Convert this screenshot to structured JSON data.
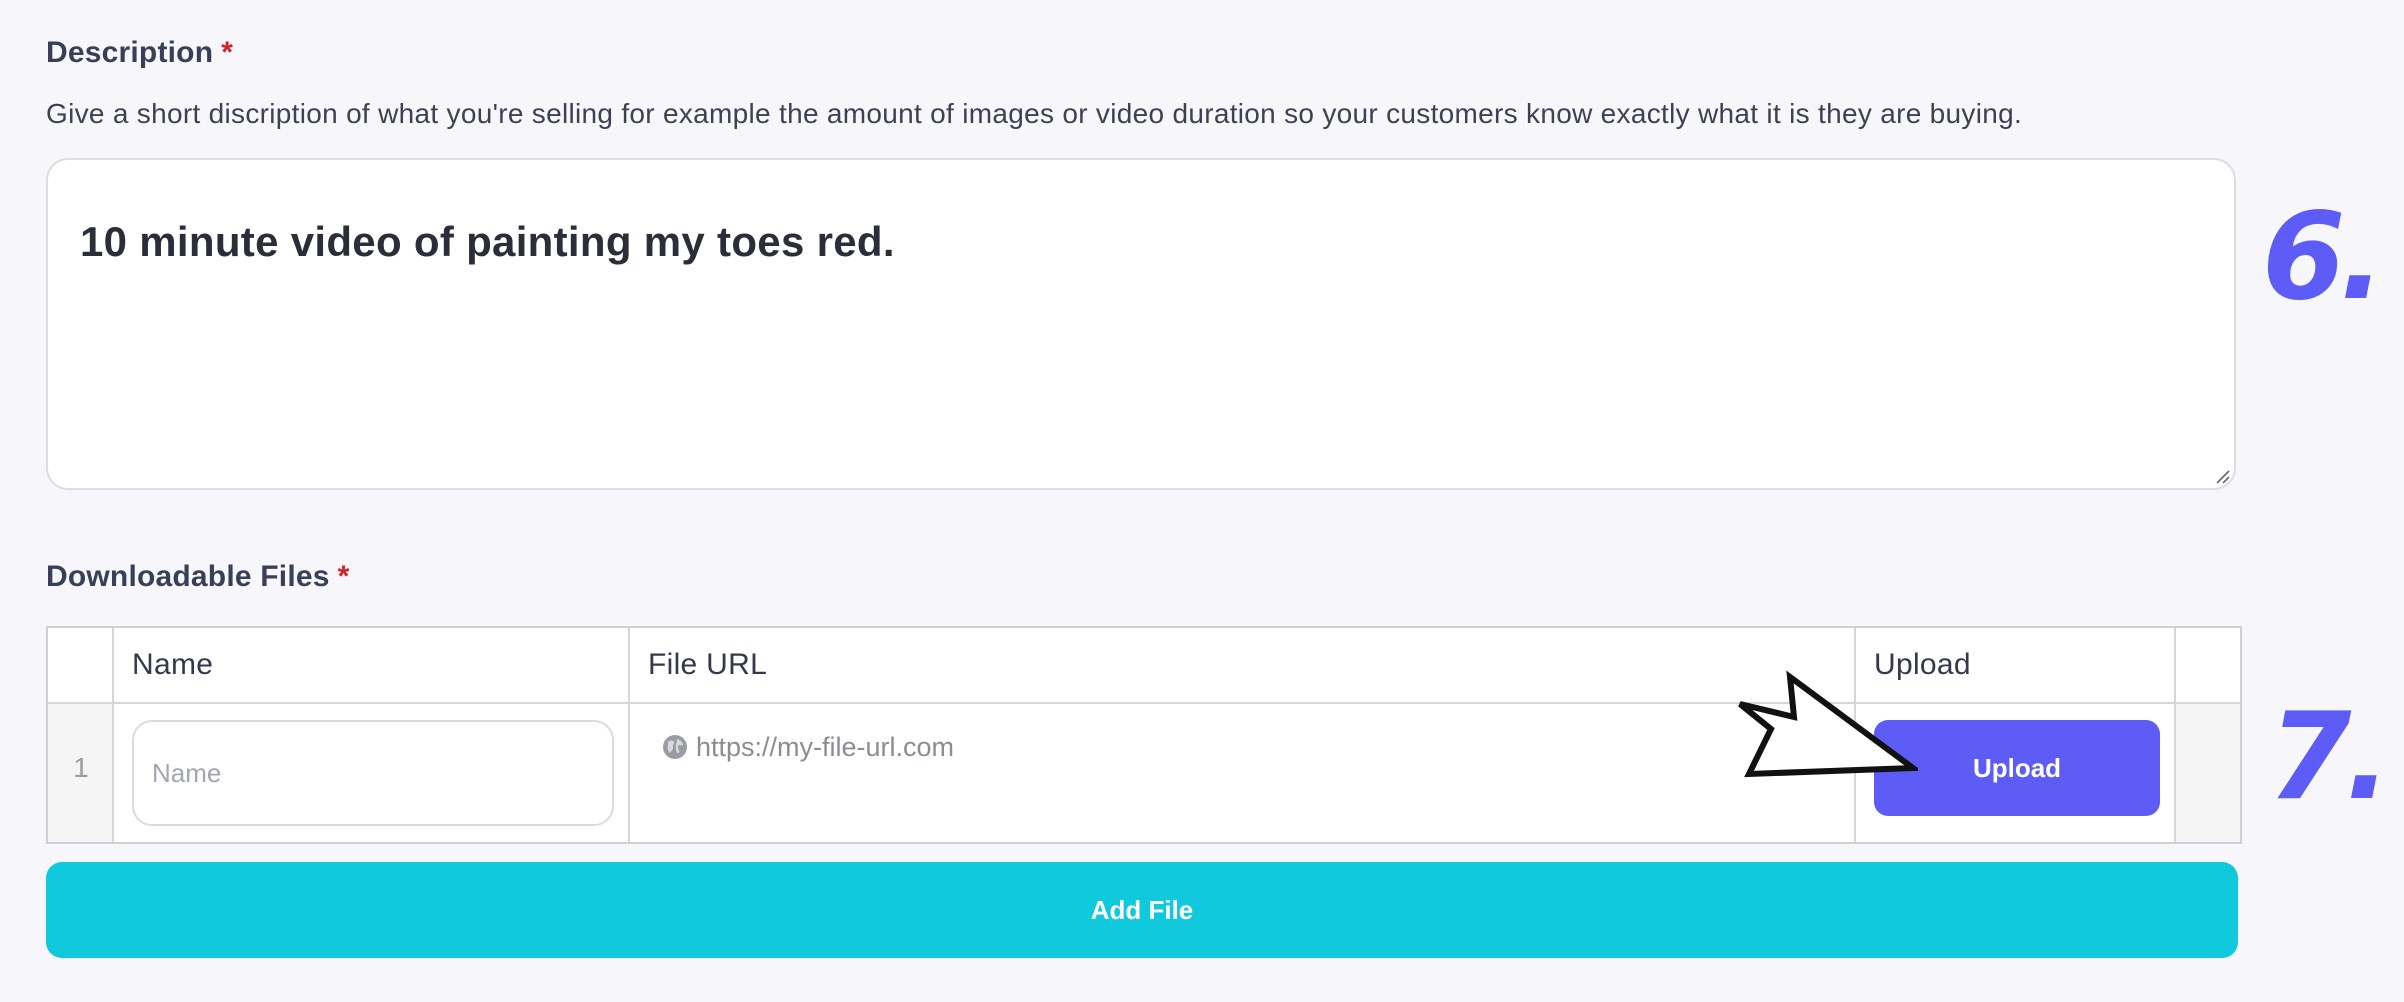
{
  "description": {
    "label": "Description",
    "required_mark": "*",
    "help_text": "Give a short discription of what you're selling for example the amount of images or video duration so your customers know exactly what it is they are buying.",
    "value": "10 minute video of painting my toes red."
  },
  "files": {
    "label": "Downloadable Files",
    "required_mark": "*",
    "columns": [
      "Name",
      "File URL",
      "Upload"
    ],
    "rows": [
      {
        "index": "1",
        "name_placeholder": "Name",
        "url_placeholder": "https://my-file-url.com",
        "upload_label": "Upload"
      }
    ],
    "add_label": "Add File"
  },
  "steps": {
    "description_step": "6.",
    "files_step": "7."
  },
  "icons": {
    "url": "globe-icon",
    "pointer": "cursor-arrow-icon",
    "resize": "resize-grip-icon"
  },
  "colors": {
    "primary": "#5e5cf6",
    "accent": "#10c9dc",
    "required": "#d4202b",
    "background": "#f7f7fb"
  }
}
